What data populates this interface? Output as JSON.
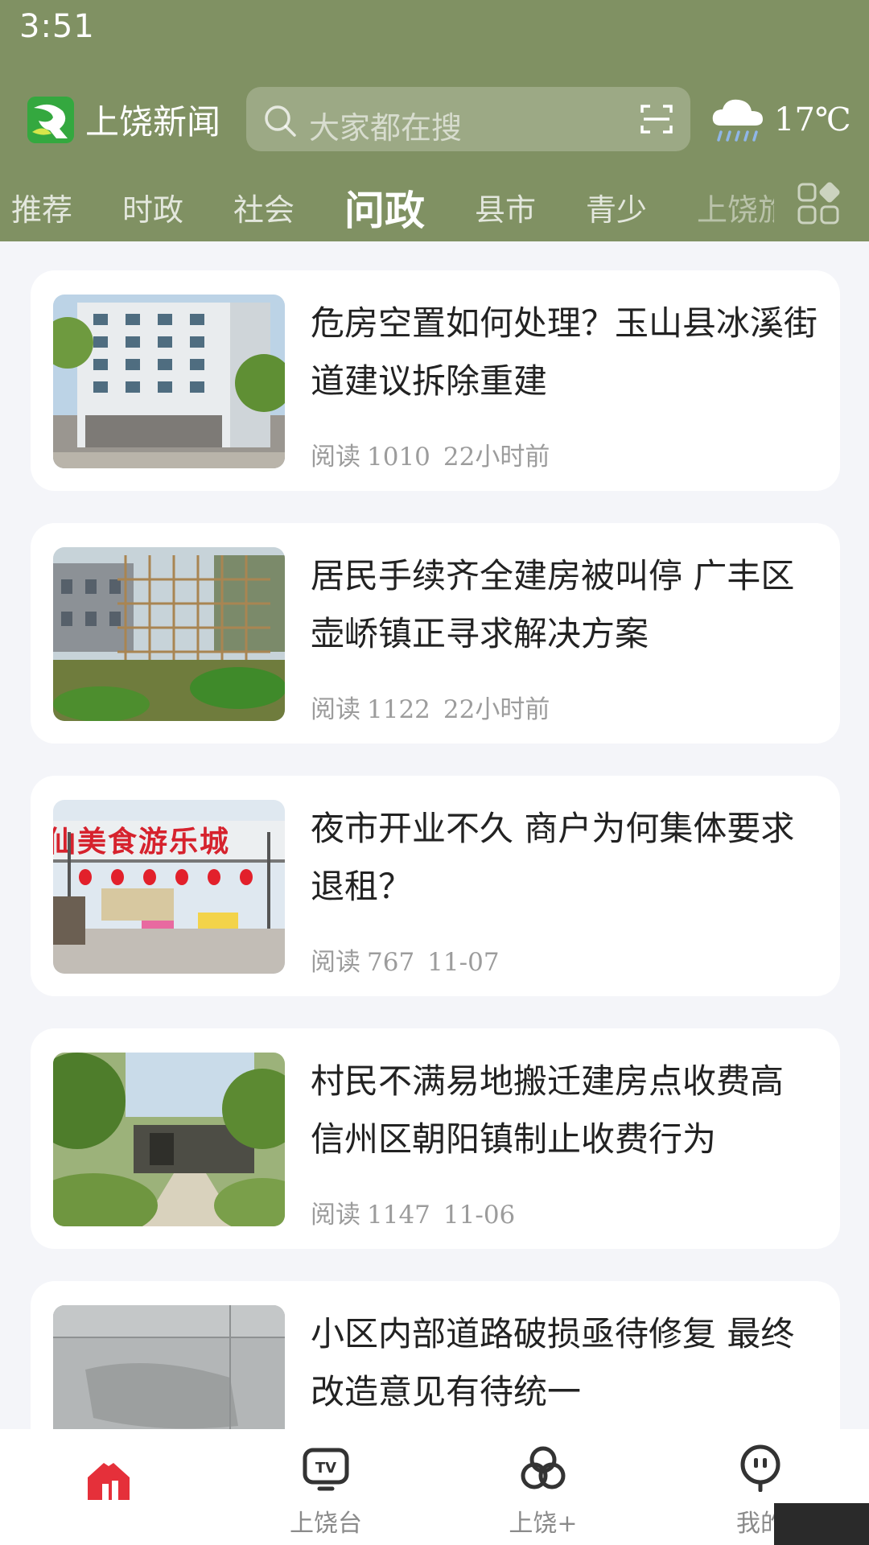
{
  "status_bar": {
    "time": "3:51"
  },
  "header": {
    "app_name": "上饶新闻",
    "search_placeholder": "大家都在搜",
    "temperature": "17℃",
    "weather_icon": "rain-cloud-icon",
    "colors": {
      "header_bg": "#809163"
    }
  },
  "tabs": [
    {
      "label": "推荐"
    },
    {
      "label": "时政"
    },
    {
      "label": "社会"
    },
    {
      "label": "问政",
      "active": true
    },
    {
      "label": "县市"
    },
    {
      "label": "青少"
    },
    {
      "label": "上饶旅"
    }
  ],
  "articles": [
    {
      "title": "危房空置如何处理？玉山县冰溪街道建议拆除重建",
      "reads_label": "阅读",
      "reads": "1010",
      "time": "22小时前",
      "thumb": "building-photo"
    },
    {
      "title": "居民手续齐全建房被叫停 广丰区壶峤镇正寻求解决方案",
      "reads_label": "阅读",
      "reads": "1122",
      "time": "22小时前",
      "thumb": "scaffold-photo"
    },
    {
      "title": "夜市开业不久 商户为何集体要求退租？",
      "reads_label": "阅读",
      "reads": "767",
      "time": "11-07",
      "thumb": "night-market-photo",
      "sign_text": "仙美食游乐城"
    },
    {
      "title": "村民不满易地搬迁建房点收费高 信州区朝阳镇制止收费行为",
      "reads_label": "阅读",
      "reads": "1147",
      "time": "11-06",
      "thumb": "overgrown-path-photo"
    },
    {
      "title": "小区内部道路破损亟待修复 最终改造意见有待统一",
      "thumb": "damaged-road-photo"
    }
  ],
  "bottom_nav": [
    {
      "label": "",
      "icon": "home-icon",
      "active": true
    },
    {
      "label": "上饶台",
      "icon": "tv-icon"
    },
    {
      "label": "上饶+",
      "icon": "circles-icon"
    },
    {
      "label": "我的",
      "icon": "profile-icon"
    }
  ],
  "accent_colors": {
    "home_active": "#e5303a"
  }
}
